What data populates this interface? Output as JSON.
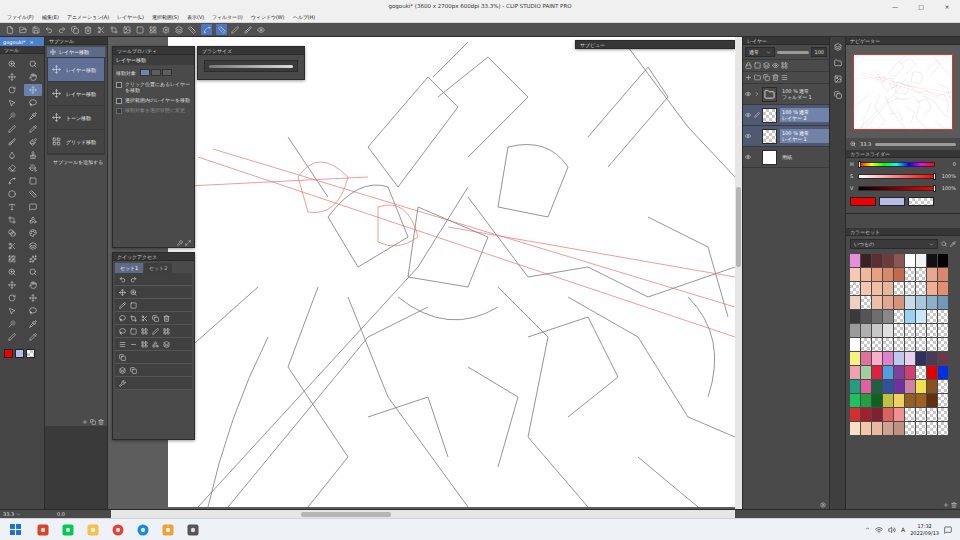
{
  "window": {
    "title": "gogouki* (3600 x 2700px 600dpi 33.3%) - CLIP STUDIO PAINT PRO",
    "controls": [
      "—",
      "□",
      "×"
    ]
  },
  "menu": [
    "ファイル(F)",
    "編集(E)",
    "アニメーション(A)",
    "レイヤー(L)",
    "選択範囲(S)",
    "表示(V)",
    "フィルター(I)",
    "ウィンドウ(W)",
    "ヘルプ(H)"
  ],
  "command_bar": [
    {
      "selected": false
    },
    {
      "selected": false
    },
    {
      "selected": false
    },
    {
      "selected": false
    },
    {
      "selected": false
    },
    {
      "selected": false
    },
    {
      "selected": false
    },
    {
      "selected": false
    },
    {
      "selected": false
    },
    {
      "selected": false
    },
    {
      "selected": false
    },
    {
      "selected": false
    },
    {
      "selected": false
    },
    {
      "selected": false
    },
    {
      "selected": false
    },
    {
      "selected": true
    },
    {
      "selected": true
    },
    {
      "selected": false
    },
    {
      "selected": false
    },
    {
      "selected": false
    }
  ],
  "document_tab": {
    "label": "gogouki*",
    "close": "×"
  },
  "tool_panel": {
    "title": "ツール",
    "tools": [
      {
        "selected": false
      },
      {
        "selected": false
      },
      {
        "selected": false
      },
      {
        "selected": false
      },
      {
        "selected": false
      },
      {
        "selected": true
      },
      {
        "selected": false
      },
      {
        "selected": false
      },
      {
        "selected": false
      },
      {
        "selected": false
      },
      {
        "selected": false
      },
      {
        "selected": false
      },
      {
        "selected": false
      },
      {
        "selected": false
      },
      {
        "selected": false
      },
      {
        "selected": false
      },
      {
        "selected": false
      },
      {
        "selected": false
      },
      {
        "selected": false
      },
      {
        "selected": false
      },
      {
        "selected": false
      },
      {
        "selected": false
      },
      {
        "selected": false
      },
      {
        "selected": false
      },
      {
        "selected": false
      },
      {
        "selected": false
      },
      {
        "selected": false
      },
      {
        "selected": false
      },
      {
        "selected": false
      },
      {
        "selected": false
      },
      {
        "selected": false
      },
      {
        "selected": false
      },
      {
        "selected": false
      },
      {
        "selected": false
      },
      {
        "selected": false
      },
      {
        "selected": false
      },
      {
        "selected": false
      },
      {
        "selected": false
      },
      {
        "selected": false
      },
      {
        "selected": false
      },
      {
        "selected": false
      },
      {
        "selected": false
      },
      {
        "selected": false
      },
      {
        "selected": false
      }
    ],
    "colors": [
      {
        "color": "#ee0000"
      },
      {
        "color": "#b8bce8"
      },
      {
        "empty": true
      }
    ]
  },
  "sub_tool": {
    "title": "サブツール",
    "group": "レイヤー移動",
    "items": [
      {
        "label": "レイヤー移動",
        "selected": true
      },
      {
        "label": "レイヤー移動",
        "selected": false
      },
      {
        "label": "トーン移動",
        "selected": false
      },
      {
        "label": "グリッド移動",
        "selected": false
      }
    ],
    "add": "サブツールを追加する"
  },
  "tool_property": {
    "title": "ツールプロパティ",
    "tool": "レイヤー移動",
    "target_label": "移動対象",
    "targets": [
      {
        "selected": true
      },
      {
        "selected": false
      },
      {
        "selected": false
      }
    ],
    "options": [
      {
        "label": "クリック位置にあるレイヤーを移動",
        "checked": false,
        "disabled": false
      },
      {
        "label": "選択範囲内のレイヤーを移動",
        "checked": false,
        "disabled": false
      },
      {
        "label": "移動対象を選択状態に変更",
        "checked": false,
        "disabled": true
      }
    ]
  },
  "brush_size": {
    "title": "ブラシサイズ"
  },
  "quick_access": {
    "title": "クイックアクセス",
    "tabs": [
      {
        "label": "セット1",
        "selected": true
      },
      {
        "label": "セット2",
        "selected": false
      }
    ]
  },
  "sub_view": {
    "title": "サブビュー"
  },
  "layers": {
    "title": "レイヤー",
    "blend": "通常",
    "opacity": "100",
    "items": [
      {
        "kind": "folder",
        "mode": "100 % 通常",
        "name": "フォルダー 1",
        "selected": false,
        "editing": false
      },
      {
        "kind": "layer",
        "mode": "100 % 通常",
        "name": "レイヤー 2",
        "selected": true,
        "editing": true
      },
      {
        "kind": "layer",
        "mode": "100 % 通常",
        "name": "レイヤー 1",
        "selected": true,
        "editing": false
      },
      {
        "kind": "paper",
        "mode": "",
        "name": "用紙",
        "selected": false,
        "editing": false
      }
    ]
  },
  "navigator": {
    "title": "ナビゲーター",
    "zoom": "33.3"
  },
  "color_slider": {
    "title": "カラースライダー",
    "channels": [
      {
        "name": "H",
        "kind": "hue",
        "reading": "0",
        "level": 0
      },
      {
        "name": "S",
        "kind": "saturation",
        "reading": "100%",
        "level": 1
      },
      {
        "name": "V",
        "kind": "value",
        "reading": "100%",
        "level": 1
      }
    ],
    "colors": [
      {
        "color": "#ee0000"
      },
      {
        "color": "#b8bce8"
      },
      {
        "empty": true
      }
    ]
  },
  "color_set": {
    "title": "カラーセット",
    "set": "いつもの",
    "swatches": [
      {
        "color": "#e78ed8"
      },
      {
        "color": "#3b2222"
      },
      {
        "color": "#5b2f2f"
      },
      {
        "color": "#6e3b3b"
      },
      {
        "color": "#8e5555"
      },
      {
        "color": "#ffffff"
      },
      {
        "color": "#f2f2f2"
      },
      {
        "color": "#111111"
      },
      {
        "color": "#000000"
      },
      {
        "color": "#f7c9b5"
      },
      {
        "color": "#f0b89a"
      },
      {
        "color": "#e8a07e"
      },
      {
        "color": "#d9886a"
      },
      {
        "color": "#c06a50"
      },
      {
        "empty": true
      },
      {
        "empty": true
      },
      {
        "color": "#e8a890"
      },
      {
        "color": "#d98870"
      },
      {
        "empty": true
      },
      {
        "color": "#f5c7b0"
      },
      {
        "color": "#eebfa5"
      },
      {
        "color": "#e8b49a"
      },
      {
        "empty": true
      },
      {
        "empty": true
      },
      {
        "empty": true
      },
      {
        "color": "#f0b090"
      },
      {
        "color": "#e09070"
      },
      {
        "color": "#f0d0c0"
      },
      {
        "empty": true
      },
      {
        "color": "#ecc0a8"
      },
      {
        "color": "#e0a890"
      },
      {
        "color": "#d4957c"
      },
      {
        "color": "#c9dbe8"
      },
      {
        "color": "#a9c7dd"
      },
      {
        "color": "#8db0cc"
      },
      {
        "color": "#7098b8"
      },
      {
        "color": "#3a3a3a"
      },
      {
        "color": "#555555"
      },
      {
        "color": "#6e6e6e"
      },
      {
        "color": "#888888"
      },
      {
        "empty": true
      },
      {
        "color": "#9ad0f0"
      },
      {
        "color": "#c8e8f8"
      },
      {
        "empty": true
      },
      {
        "empty": true
      },
      {
        "color": "#9a9a9a"
      },
      {
        "color": "#b0b0b0"
      },
      {
        "color": "#c8c8c8"
      },
      {
        "color": "#e0e0e0"
      },
      {
        "empty": true
      },
      {
        "empty": true
      },
      {
        "empty": true
      },
      {
        "empty": true
      },
      {
        "empty": true
      },
      {
        "color": "#ffffff"
      },
      {
        "empty": true
      },
      {
        "empty": true
      },
      {
        "empty": true
      },
      {
        "empty": true
      },
      {
        "empty": true
      },
      {
        "empty": true
      },
      {
        "empty": true
      },
      {
        "empty": true
      },
      {
        "color": "#f8f080"
      },
      {
        "color": "#e070a0"
      },
      {
        "color": "#f8b0c8"
      },
      {
        "color": "#e080d0"
      },
      {
        "color": "#c0c8f0"
      },
      {
        "color": "#e8d0f0"
      },
      {
        "color": "#303060"
      },
      {
        "color": "#4a3a5a"
      },
      {
        "color": "#6a3a4a"
      },
      {
        "color": "#f0a0b0"
      },
      {
        "color": "#a0d0a0"
      },
      {
        "color": "#e02040"
      },
      {
        "color": "#50a0e0"
      },
      {
        "color": "#8040a0"
      },
      {
        "color": "#d04070"
      },
      {
        "empty": true
      },
      {
        "color": "#e00000"
      },
      {
        "color": "#0030e0"
      },
      {
        "color": "#20a080"
      },
      {
        "color": "#e060a0"
      },
      {
        "color": "#206040"
      },
      {
        "color": "#3050a0"
      },
      {
        "color": "#7030a0"
      },
      {
        "color": "#d080a0"
      },
      {
        "color": "#f0e050"
      },
      {
        "color": "#8a5020"
      },
      {
        "empty": true
      },
      {
        "color": "#20c060"
      },
      {
        "color": "#20a040"
      },
      {
        "color": "#106020"
      },
      {
        "color": "#c0c040"
      },
      {
        "color": "#f0d060"
      },
      {
        "color": "#906020"
      },
      {
        "color": "#a06020"
      },
      {
        "color": "#603010"
      },
      {
        "empty": true
      },
      {
        "color": "#d03030"
      },
      {
        "color": "#a02030"
      },
      {
        "color": "#802030"
      },
      {
        "color": "#e06060"
      },
      {
        "color": "#f09090"
      },
      {
        "empty": true
      },
      {
        "empty": true
      },
      {
        "empty": true
      },
      {
        "empty": true
      },
      {
        "color": "#f8e0c8"
      },
      {
        "color": "#f0c8a8"
      },
      {
        "color": "#e8b8a0"
      },
      {
        "color": "#d0a090"
      },
      {
        "color": "#c09080"
      },
      {
        "empty": true
      },
      {
        "empty": true
      },
      {
        "empty": true
      },
      {
        "empty": true
      }
    ]
  },
  "status_bar": {
    "zoom": "33.3",
    "angle": "0.0"
  },
  "taskbar": {
    "tray_arrow": "^",
    "ime": "A",
    "time": "17:32",
    "date": "2022/09/13"
  }
}
